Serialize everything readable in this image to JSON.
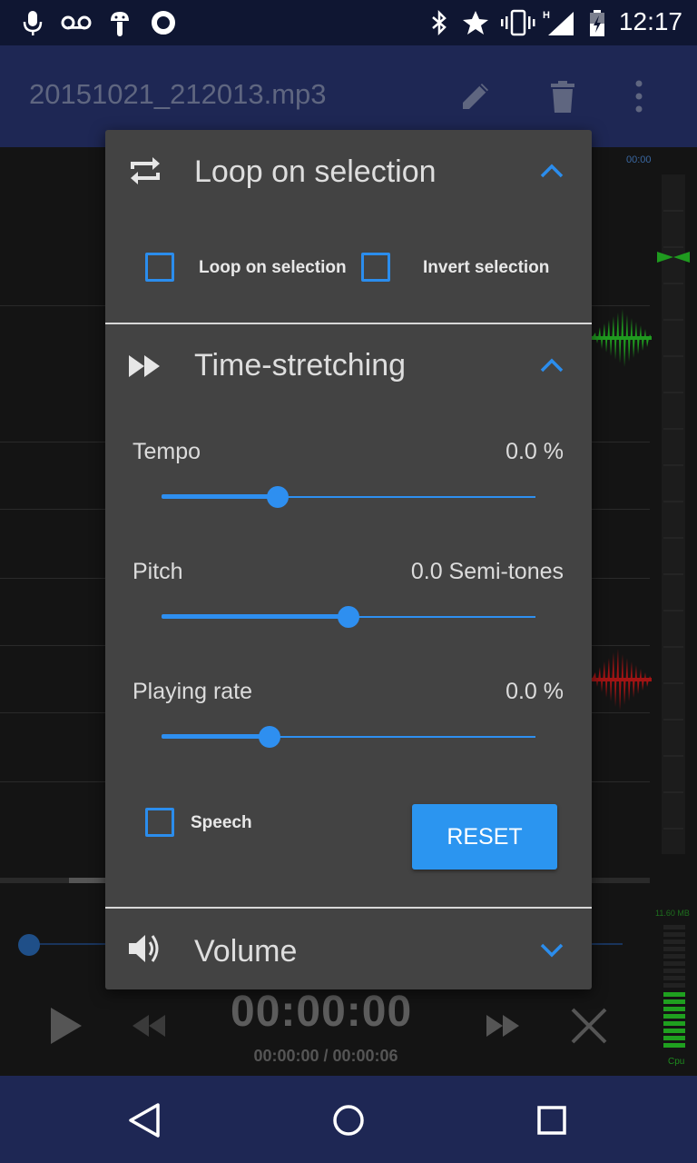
{
  "status_bar": {
    "time": "12:17",
    "left_icons": [
      "microphone-icon",
      "voicemail-icon",
      "android-icon",
      "circle-app-icon"
    ],
    "right_icons": [
      "bluetooth-icon",
      "star-icon",
      "vibrate-icon",
      "signal-h-icon",
      "battery-icon"
    ]
  },
  "toolbar": {
    "file_name": "20151021_212013.mp3",
    "actions": [
      "edit-icon",
      "delete-icon",
      "more-vert-icon"
    ]
  },
  "editor": {
    "ruler_time": "00:00",
    "memory_label": "11.60 MB",
    "cpu_label": "Cpu",
    "colors": {
      "left_channel": "#1f9a1f",
      "right_channel": "#a01414"
    }
  },
  "playback": {
    "current_time": "00:00:00",
    "position_duration": "00:00:00 / 00:00:06"
  },
  "dialog": {
    "loop": {
      "title": "Loop on selection",
      "loop_checkbox_label": "Loop on selection",
      "invert_checkbox_label": "Invert selection",
      "loop_checked": false,
      "invert_checked": false
    },
    "time_stretching": {
      "title": "Time-stretching",
      "tempo": {
        "label": "Tempo",
        "value": "0.0 %",
        "position": 0.31
      },
      "pitch": {
        "label": "Pitch",
        "value": "0.0 Semi-tones",
        "position": 0.5
      },
      "rate": {
        "label": "Playing rate",
        "value": "0.0 %",
        "position": 0.29
      },
      "speech_label": "Speech",
      "speech_checked": false,
      "reset_label": "RESET"
    },
    "volume": {
      "title": "Volume"
    }
  },
  "accent_color": "#2e8ff0"
}
